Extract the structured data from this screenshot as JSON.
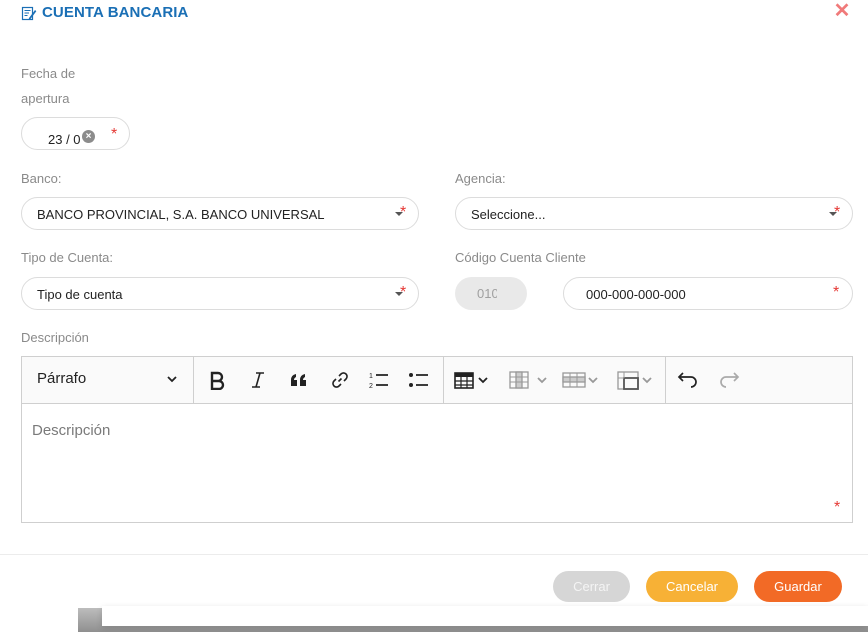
{
  "modal": {
    "title": "CUENTA BANCARIA",
    "close_icon": "close-icon"
  },
  "form": {
    "fecha_label_line1": "Fecha de",
    "fecha_label_line2": "apertura",
    "fecha_value": "23 / 0",
    "banco_label": "Banco:",
    "banco_value": "BANCO PROVINCIAL, S.A. BANCO UNIVERSAL",
    "agencia_label": "Agencia:",
    "agencia_value": "Seleccione...",
    "tipo_label": "Tipo de Cuenta:",
    "tipo_value": "Tipo de cuenta",
    "codigo_label": "Código Cuenta Cliente",
    "codigo_prefix": "010",
    "codigo_value": "000-000-000-000",
    "descripcion_label": "Descripción",
    "required_mark": "*"
  },
  "editor": {
    "paragraph_style": "Párrafo",
    "placeholder": "Descripción",
    "toolbar_icons": [
      "bold-icon",
      "italic-icon",
      "blockquote-icon",
      "link-icon",
      "numbered-list-icon",
      "bulleted-list-icon",
      "table-icon",
      "table-column-icon",
      "table-row-icon",
      "merge-cells-icon",
      "undo-icon",
      "redo-icon"
    ]
  },
  "footer": {
    "close_label": "Cerrar",
    "cancel_label": "Cancelar",
    "save_label": "Guardar"
  },
  "colors": {
    "title": "#1a6fb5",
    "required": "#e53935",
    "cancel": "#f7b136",
    "save": "#f26a26",
    "close_disabled": "#d6d6d6"
  }
}
